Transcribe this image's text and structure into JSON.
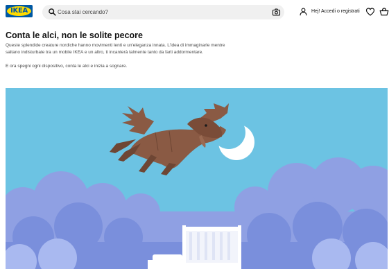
{
  "header": {
    "logo_text": "IKEA",
    "search_placeholder": "Cosa stai cercando?",
    "account_label": "Hej! Accedi o registrati",
    "icons": [
      "search-icon",
      "camera-icon",
      "user-icon",
      "heart-icon",
      "shopping-bag-icon"
    ]
  },
  "article": {
    "title": "Conta le alci, non le solite pecore",
    "paragraph_1_line_1": "Queste splendide creature nordiche hanno movimenti lenti e un'eleganza innata. L'idea di immaginarle mentre",
    "paragraph_1_line_2": "saltano indisturbate tra un mobile IKEA e un altro, ti incanterà talmente tanto da farti addormentare.",
    "paragraph_2": "E ora spegni ogni dispositivo, conta le alci e inizia a sognare."
  },
  "colors": {
    "brand_blue": "#0058a3",
    "brand_yellow": "#ffdb00",
    "sky": "#6cc3e3",
    "cloud": "#8fa0e3",
    "moose": "#8a5a44"
  }
}
